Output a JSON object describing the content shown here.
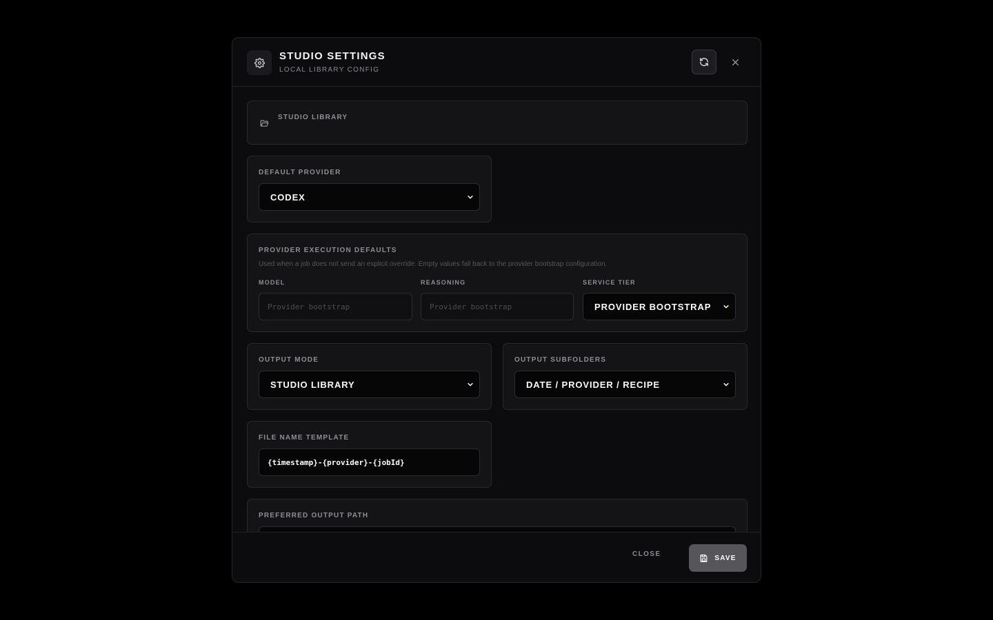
{
  "header": {
    "title": "STUDIO SETTINGS",
    "subtitle": "LOCAL LIBRARY CONFIG",
    "settings_icon": "gear-icon",
    "refresh_icon": "refresh-icon",
    "close_icon": "close-icon"
  },
  "library": {
    "label": "STUDIO LIBRARY",
    "icon": "folder-icon"
  },
  "default_provider": {
    "label": "DEFAULT PROVIDER",
    "value": "CODEX"
  },
  "execution_defaults": {
    "label": "PROVIDER EXECUTION DEFAULTS",
    "hint": "Used when a job does not send an explicit override. Empty values fall back to the provider bootstrap configuration.",
    "model": {
      "label": "MODEL",
      "placeholder": "Provider bootstrap"
    },
    "reasoning": {
      "label": "REASONING",
      "placeholder": "Provider bootstrap"
    },
    "service_tier": {
      "label": "SERVICE TIER",
      "value": "PROVIDER BOOTSTRAP"
    }
  },
  "output_mode": {
    "label": "OUTPUT MODE",
    "value": "STUDIO LIBRARY"
  },
  "output_subfolders": {
    "label": "OUTPUT SUBFOLDERS",
    "value": "DATE / PROVIDER / RECIPE"
  },
  "file_name_template": {
    "label": "FILE NAME TEMPLATE",
    "value": "{timestamp}-{provider}-{jobId}"
  },
  "preferred_output_path": {
    "label": "PREFERRED OUTPUT PATH"
  },
  "footer": {
    "close_label": "CLOSE",
    "save_label": "SAVE",
    "save_icon": "save-icon"
  }
}
